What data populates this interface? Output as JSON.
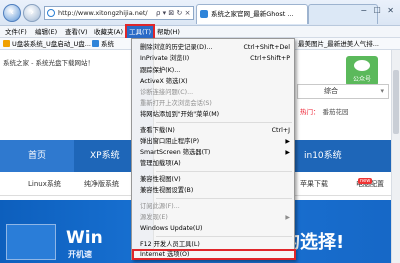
{
  "browser": {
    "url": "http://www.xitongzhijia.net/",
    "url_icons": "ρ ▾ ⊠ ↻ ×",
    "tabs": [
      {
        "label": "系统之家官网_最新Ghost ..."
      },
      {
        "label": ""
      }
    ],
    "window_controls": "− ☐ ✕"
  },
  "menubar": {
    "items": [
      "文件(F)",
      "编辑(E)",
      "查看(V)",
      "收藏夹(A)",
      "工具(T)",
      "帮助(H)"
    ]
  },
  "favbar": {
    "items": [
      "U盘装系统_U盘启动_U盘...",
      "系统",
      "美女..."
    ],
    "right_item": "最美图片_最新进美人气排..."
  },
  "page": {
    "top_note": "系统之家 - 系统光盘下载网站！",
    "search_label": "综合",
    "hot_label": "热门：",
    "hot_text": "番茄花园",
    "wechat_label": "公众号",
    "blue_nav": [
      "首页",
      "XP系统",
      "in10系统"
    ],
    "sub_nav": [
      "Linux系统",
      "纯净版系统",
      "苹果下载",
      "电脑配置"
    ],
    "new_badge": "new",
    "banner_title": "Win",
    "banner_sub": "开机速",
    "banner_slogan": "的选择!"
  },
  "menu": {
    "items": [
      {
        "label": "删除浏览的历史记录(D)...",
        "shortcut": "Ctrl+Shift+Del"
      },
      {
        "label": "InPrivate 浏览(I)",
        "shortcut": "Ctrl+Shift+P"
      },
      {
        "label": "跟踪保护(K)..."
      },
      {
        "label": "ActiveX 筛选(X)"
      },
      {
        "label": "诊断连接问题(C)...",
        "disabled": true
      },
      {
        "label": "重新打开上次浏览会话(S)",
        "disabled": true
      },
      {
        "label": "将网站添加到\"开始\"菜单(M)"
      },
      {
        "label": "查看下载(N)",
        "shortcut": "Ctrl+J"
      },
      {
        "label": "弹出窗口阻止程序(P)",
        "arrow": "▶"
      },
      {
        "label": "SmartScreen 筛选器(T)",
        "arrow": "▶"
      },
      {
        "label": "管理加载项(A)"
      },
      {
        "label": "兼容性视图(V)"
      },
      {
        "label": "兼容性视图设置(B)"
      },
      {
        "label": "订阅此源(F)...",
        "disabled": true
      },
      {
        "label": "源发现(E)",
        "disabled": true,
        "arrow": "▶"
      },
      {
        "label": "Windows Update(U)"
      },
      {
        "label": "F12 开发人员工具(L)"
      },
      {
        "label": "Internet 选项(O)"
      }
    ]
  }
}
